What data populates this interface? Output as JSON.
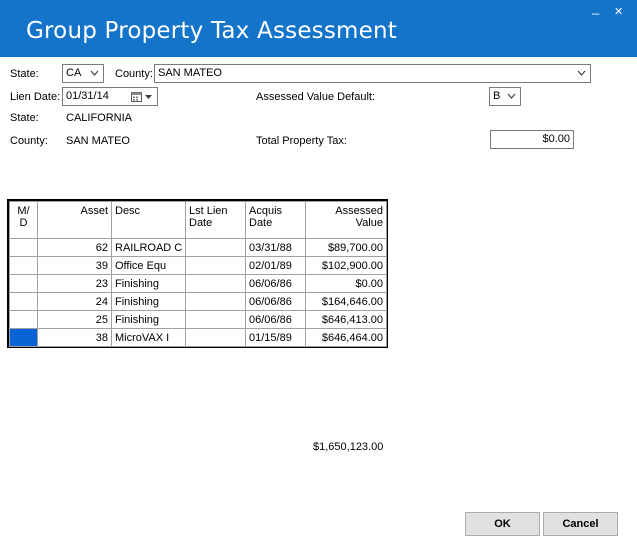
{
  "window": {
    "title": "Group Property Tax Assessment",
    "minimize_glyph": "_",
    "close_glyph": "✕"
  },
  "form": {
    "state_label": "State:",
    "state_value": "CA",
    "county_label": "County:",
    "county_value": "SAN MATEO",
    "lien_date_label": "Lien Date:",
    "lien_date_value": "01/31/14",
    "assessed_default_label": "Assessed Value Default:",
    "assessed_default_value": "B",
    "state_name_label": "State:",
    "state_name_value": "CALIFORNIA",
    "county_name_label": "County:",
    "county_name_value": "SAN MATEO",
    "total_tax_label": "Total Property Tax:",
    "total_tax_value": "$0.00"
  },
  "grid": {
    "headers": {
      "md": "M/\nD",
      "asset": "Asset",
      "desc": "Desc",
      "lien": "Lst Lien\nDate",
      "acq": "Acquis\nDate",
      "value": "Assessed\nValue"
    },
    "rows": [
      {
        "md": "",
        "asset": "62",
        "desc": "RAILROAD C",
        "lien": "",
        "acq": "03/31/88",
        "value": "$89,700.00"
      },
      {
        "md": "",
        "asset": "39",
        "desc": "Office Equ",
        "lien": "",
        "acq": "02/01/89",
        "value": "$102,900.00"
      },
      {
        "md": "",
        "asset": "23",
        "desc": "Finishing",
        "lien": "",
        "acq": "06/06/86",
        "value": "$0.00"
      },
      {
        "md": "",
        "asset": "24",
        "desc": "Finishing",
        "lien": "",
        "acq": "06/06/86",
        "value": "$164,646.00"
      },
      {
        "md": "",
        "asset": "25",
        "desc": "Finishing",
        "lien": "",
        "acq": "06/06/86",
        "value": "$646,413.00"
      },
      {
        "md": "",
        "asset": "38",
        "desc": "MicroVAX I",
        "lien": "",
        "acq": "01/15/89",
        "value": "$646,464.00"
      }
    ],
    "selected_row": 5,
    "total": "$1,650,123.00"
  },
  "buttons": {
    "ok": "OK",
    "cancel": "Cancel"
  },
  "colors": {
    "titlebar": "#1474c9",
    "selection": "#0a64d6"
  }
}
